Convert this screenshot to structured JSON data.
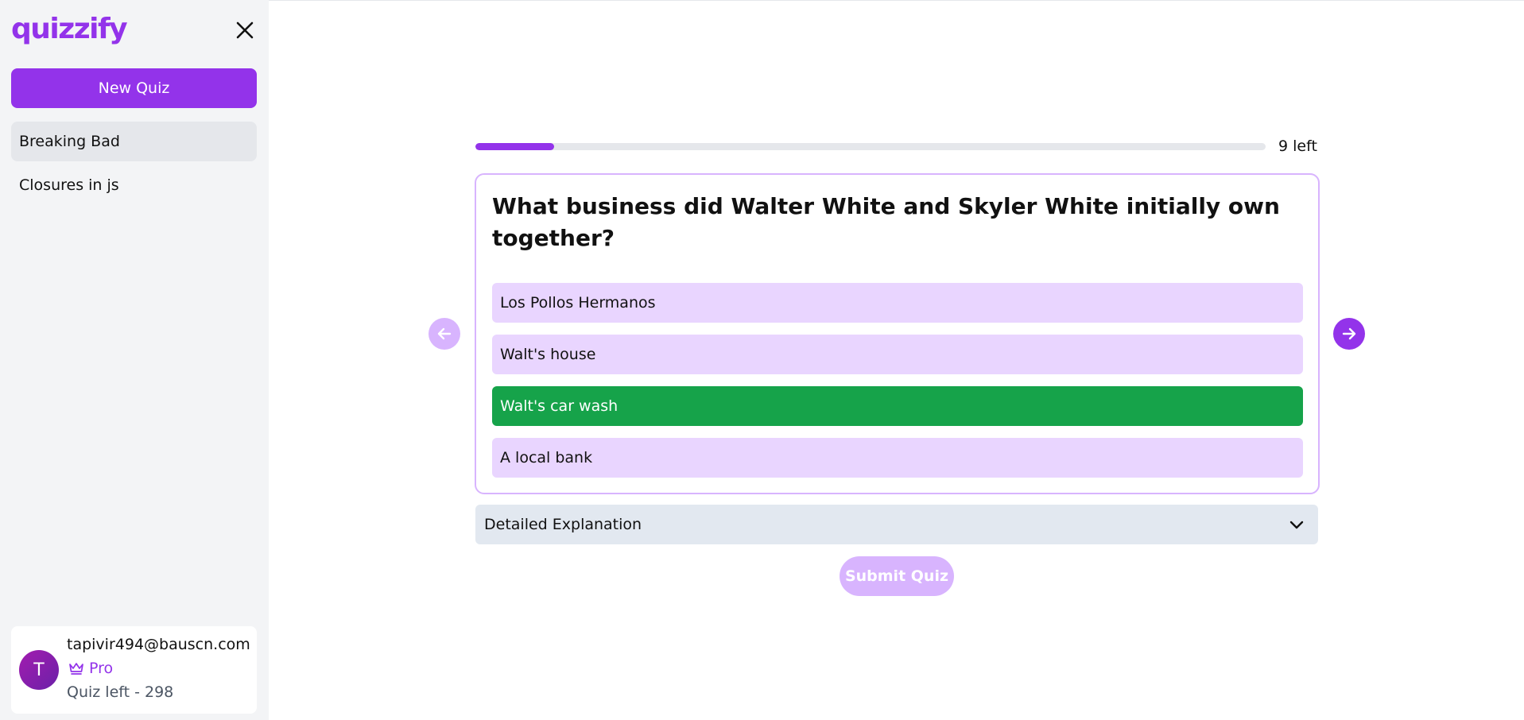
{
  "app": {
    "logo": "quizzify"
  },
  "sidebar": {
    "new_quiz_label": "New Quiz",
    "items": [
      {
        "label": "Breaking Bad",
        "active": true
      },
      {
        "label": "Closures in js",
        "active": false
      }
    ],
    "close_icon": "close-icon"
  },
  "user": {
    "avatar_initial": "T",
    "email": "tapivir494@bauscn.com",
    "plan": "Pro",
    "plan_icon": "crown-icon",
    "quiz_left": "Quiz left - 298"
  },
  "quiz": {
    "progress_fraction": 0.1,
    "remaining_label": "9 left",
    "question": "What business did Walter White and Skyler White initially own together?",
    "options": [
      {
        "label": "Los Pollos Hermanos",
        "state": "default"
      },
      {
        "label": "Walt's house",
        "state": "default"
      },
      {
        "label": "Walt's car wash",
        "state": "correct"
      },
      {
        "label": "A local bank",
        "state": "default"
      }
    ],
    "prev_icon": "arrow-left-icon",
    "next_icon": "arrow-right-icon",
    "explanation_label": "Detailed Explanation",
    "explanation_icon": "chevron-down-icon",
    "submit_label": "Submit Quiz"
  },
  "colors": {
    "accent": "#9333ea",
    "accent_light": "#d8b4fe",
    "option_bg": "#e9d5ff",
    "correct": "#16a34a"
  }
}
